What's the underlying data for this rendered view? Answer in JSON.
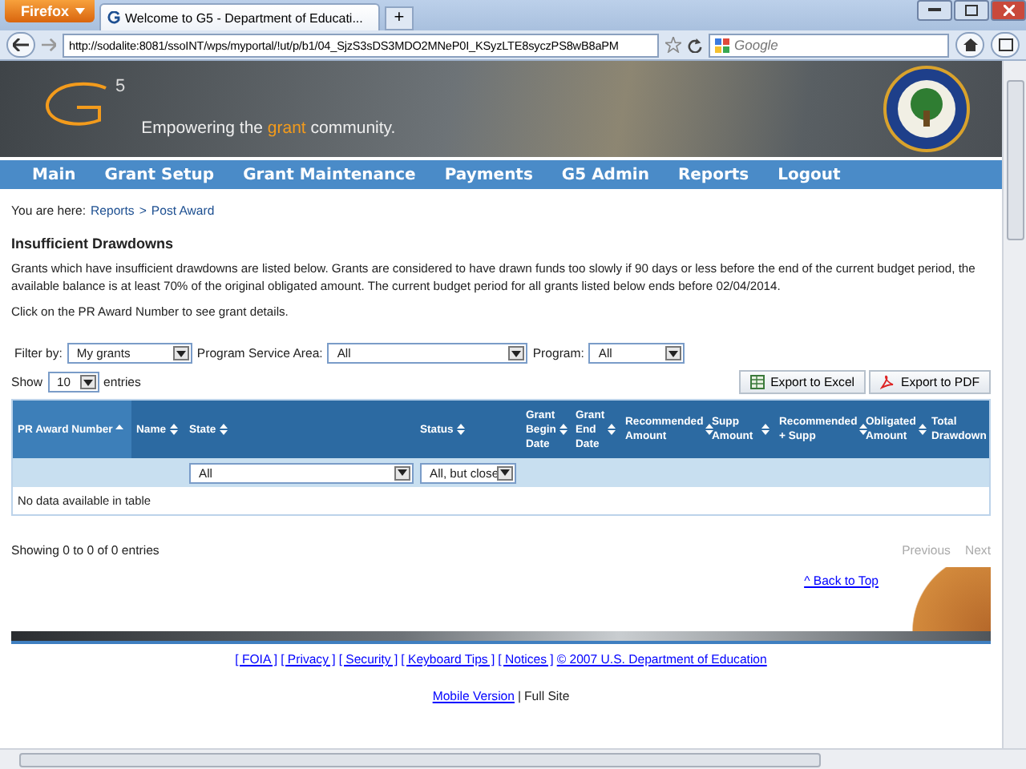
{
  "browser": {
    "app_button": "Firefox",
    "tab_title": "Welcome to G5 - Department of Educati...",
    "new_tab": "+",
    "url": "http://sodalite:8081/ssoINT/wps/myportal/!ut/p/b1/04_SjzS3sDS3MDO2MNeP0I_KSyzLTE8syczPS8wB8aPM",
    "search_placeholder": "Google"
  },
  "banner": {
    "logo_sup": "5",
    "tagline_before": "Empowering the ",
    "tagline_highlight": "grant",
    "tagline_after": " community."
  },
  "nav": [
    "Main",
    "Grant Setup",
    "Grant Maintenance",
    "Payments",
    "G5 Admin",
    "Reports",
    "Logout"
  ],
  "breadcrumb": {
    "prefix": "You are here:",
    "links": [
      "Reports",
      "Post Award"
    ],
    "separator": ">"
  },
  "heading": "Insufficient Drawdowns",
  "description": "Grants which have insufficient drawdowns are listed below. Grants are considered to have drawn funds too slowly if 90 days or less before the end of the current budget period, the available balance is at least 70% of the original obligated amount. The current budget period for all grants listed below ends before 02/04/2014.",
  "instruction": "Click on the PR Award Number to see grant details.",
  "filters": [
    {
      "label": "Filter by:",
      "value": "My grants"
    },
    {
      "label": "Program Service Area:",
      "value": "All"
    },
    {
      "label": "Program:",
      "value": "All"
    }
  ],
  "show": {
    "label": "Show",
    "value": "10",
    "suffix": "entries"
  },
  "exports": [
    {
      "kind": "excel",
      "label": "Export to Excel"
    },
    {
      "kind": "pdf",
      "label": "Export to PDF"
    }
  ],
  "table": {
    "columns": [
      {
        "label": "PR Award Number",
        "sorted": true
      },
      {
        "label": "Name",
        "sorted": false
      },
      {
        "label": "State",
        "sorted": false
      },
      {
        "label": "Status",
        "sorted": false
      },
      {
        "label": "Grant Begin Date",
        "sorted": false
      },
      {
        "label": "Grant End Date",
        "sorted": false
      },
      {
        "label": "Recommended Amount",
        "sorted": false
      },
      {
        "label": "Supp Amount",
        "sorted": false
      },
      {
        "label": "Recommended + Supp",
        "sorted": false
      },
      {
        "label": "Obligated Amount",
        "sorted": false
      },
      {
        "label": "Total Drawdown",
        "sorted": false
      }
    ],
    "filter_row": [
      {
        "kind": "empty"
      },
      {
        "kind": "empty"
      },
      {
        "kind": "select",
        "value": "All"
      },
      {
        "kind": "select",
        "value": "All, but close"
      },
      {
        "kind": "empty"
      },
      {
        "kind": "empty"
      },
      {
        "kind": "empty"
      },
      {
        "kind": "empty"
      },
      {
        "kind": "empty"
      },
      {
        "kind": "empty"
      },
      {
        "kind": "empty"
      }
    ],
    "empty_message": "No data available in table"
  },
  "info": "Showing 0 to 0 of 0 entries",
  "pagination": [
    {
      "label": "Previous",
      "disabled": true
    },
    {
      "label": "Next",
      "disabled": true
    }
  ],
  "back_to_top": "^ Back to Top",
  "footer_links": [
    "[ FOIA ]",
    "[ Privacy ]",
    "[ Security ]",
    "[ Keyboard Tips ]",
    "[ Notices ]",
    "© 2007 U.S. Department of Education"
  ],
  "footer_view": {
    "link": "Mobile Version",
    "separator": "|",
    "current": "Full Site"
  }
}
